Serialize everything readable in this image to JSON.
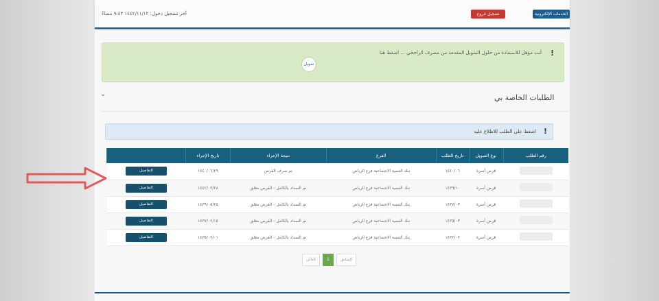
{
  "header": {
    "last_login": "آخر تسجيل دخول: ١٤٤٢/١١/١٢ ٩:٤٣ مساءً",
    "services_button": "الخدمات الإلكترونية",
    "logout_button": "تسجيل خروج"
  },
  "notice": {
    "text": "أنت مؤهل للاستفادة من حلول التمويل المقدمة من مصرف الراجحي ... اضغط هنا",
    "logo": "تمويل"
  },
  "section": {
    "title": "الطلبات الخاصة بي",
    "info": "اضغط على الطلب للاطلاع عليه"
  },
  "table": {
    "headers": [
      "رقم الطلب",
      "نوع التمويل",
      "تاريخ الطلب",
      "الفرع",
      "نتيجة الإجراء",
      "تاريخ الإجراء",
      ""
    ],
    "rows": [
      {
        "type": "قرض أسرة",
        "date": "١٤٤٠/٠٦",
        "branch": "بنك التنمية الاجتماعية فرع الرياض",
        "result": "تم صرف القرض",
        "pdate": "١٤٤٠/٠٦/٢٩",
        "action": "التفاصيل"
      },
      {
        "type": "قرض أسرة",
        "date": "١٤٣٩/١٠",
        "branch": "بنك التنمية الاجتماعية فرع الرياض",
        "result": "تم السداد بالكامل - القرض مغلق",
        "pdate": "١٤٤٢/٠٣/٢٨",
        "action": "التفاصيل"
      },
      {
        "type": "قرض أسرة",
        "date": "١٤٣٧/٠٣",
        "branch": "بنك التنمية الاجتماعية فرع الرياض",
        "result": "تم السداد بالكامل - القرض مغلق",
        "pdate": "١٤٣٩/٠٥/٢٥",
        "action": "التفاصيل"
      },
      {
        "type": "قرض أسرة",
        "date": "١٤٣٥/٠٣",
        "branch": "بنك التنمية الاجتماعية فرع الرياض",
        "result": "تم السداد بالكامل - القرض مغلق",
        "pdate": "١٤٣٧/٠٢/١٥",
        "action": "التفاصيل"
      },
      {
        "type": "قرض أسرة",
        "date": "١٤٣٢/٠٢",
        "branch": "بنك التنمية الاجتماعية فرع الرياض",
        "result": "تم السداد بالكامل - القرض مغلق",
        "pdate": "١٤٣٥/٠٢/٠١",
        "action": "التفاصيل"
      }
    ]
  },
  "pagination": {
    "prev": "السابق",
    "current": "1",
    "next": "التالي"
  },
  "icons": {
    "collapse": "chevron-down-icon",
    "notice": "exclamation-icon",
    "annotation": "red-arrow-icon"
  },
  "colors": {
    "header_blue": "#17617f",
    "logout_red": "#c43b32",
    "notice_green": "#d8ebc6",
    "page_active": "#6aa84f",
    "arrow_red": "#e05a5a"
  }
}
